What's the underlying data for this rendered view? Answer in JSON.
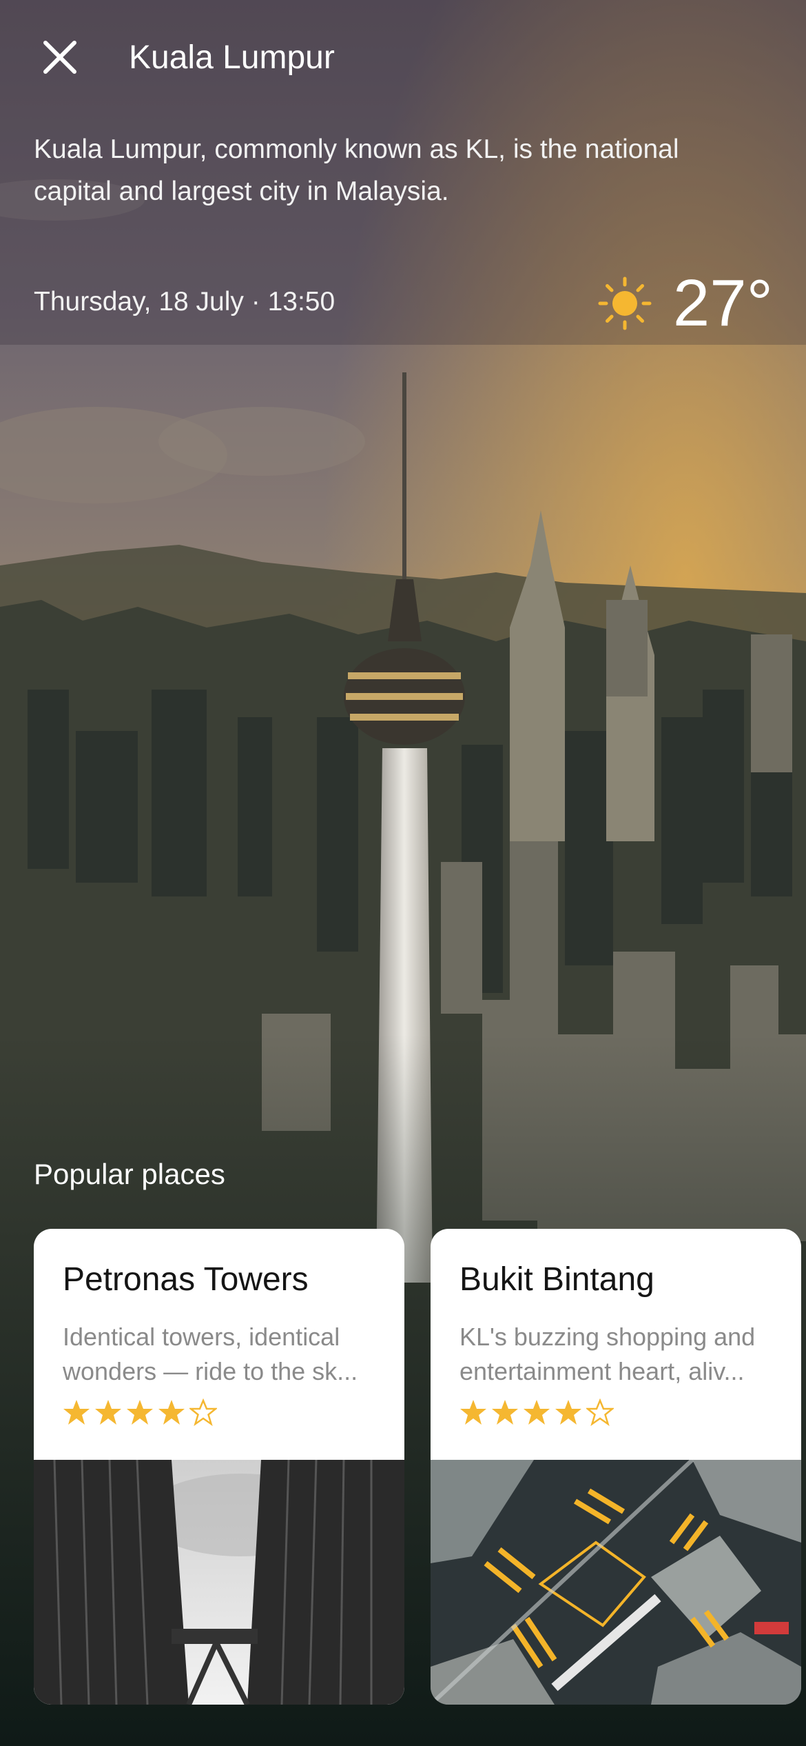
{
  "header": {
    "title": "Kuala Lumpur",
    "close_icon": "close-icon"
  },
  "city": {
    "description": "Kuala Lumpur, commonly known as KL, is the national capital and largest city in Malaysia.",
    "datetime": "Thursday, 18 July · 13:50"
  },
  "weather": {
    "icon": "sun-icon",
    "temperature": "27°",
    "icon_color": "#f5b731"
  },
  "popular": {
    "title": "Popular places",
    "places": [
      {
        "name": "Petronas Towers",
        "description": "Identical towers, identical wonders — ride to the sk...",
        "rating": 4,
        "rating_max": 5
      },
      {
        "name": "Bukit Bintang",
        "description": "KL's buzzing shopping and entertainment heart, aliv...",
        "rating": 4,
        "rating_max": 5
      }
    ]
  },
  "colors": {
    "accent": "#f5b731",
    "background_dark": "#0f1a17"
  }
}
